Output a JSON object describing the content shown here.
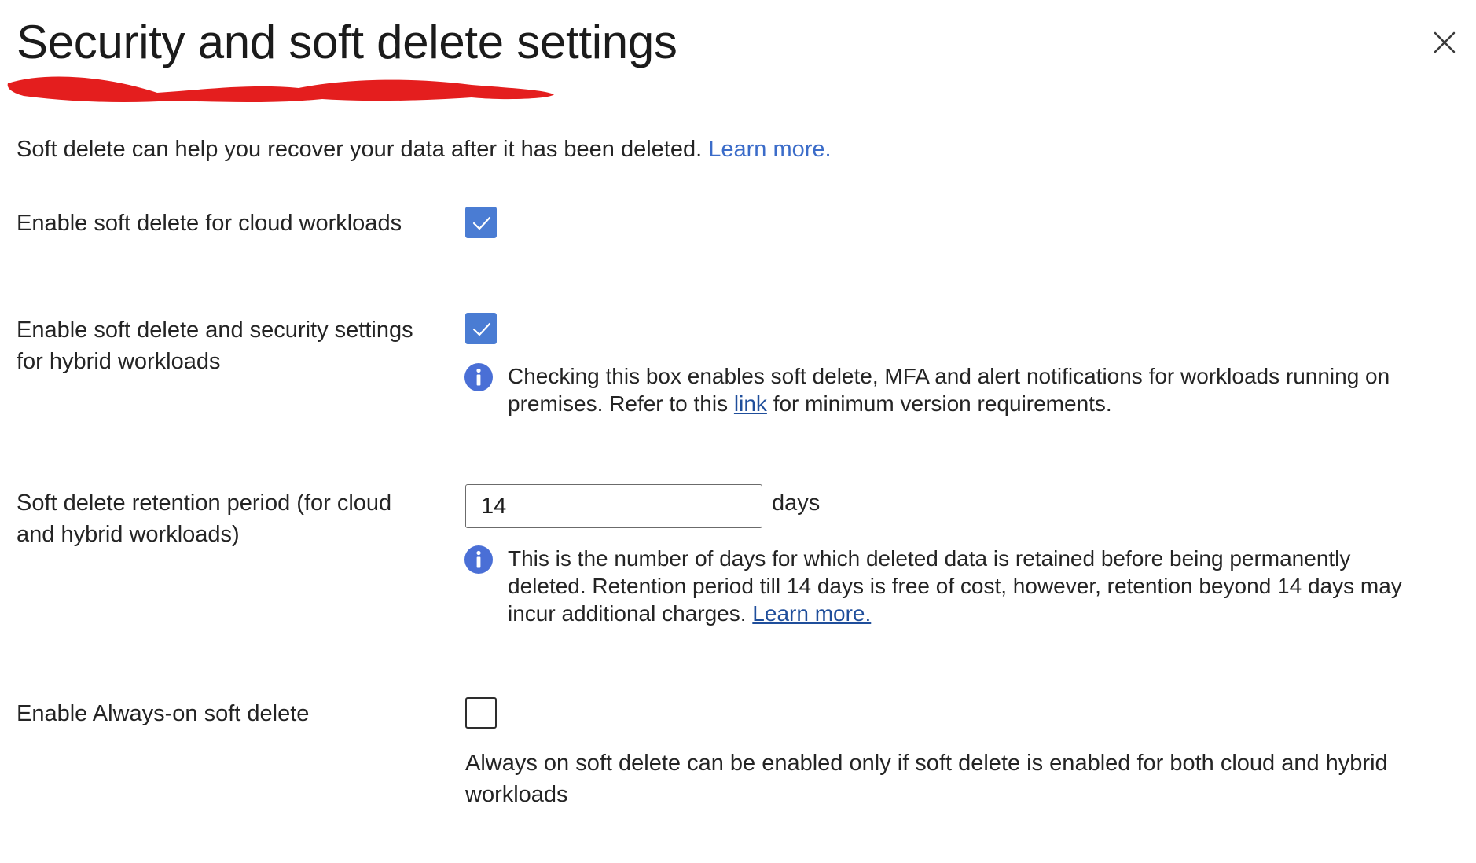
{
  "dialog": {
    "title": "Security and soft delete settings",
    "close_label": "Close"
  },
  "intro": {
    "text": "Soft delete can help you recover your data after it has been deleted.",
    "link": "Learn more."
  },
  "cloud_soft_delete": {
    "label": "Enable soft delete for cloud workloads",
    "checked": true
  },
  "hybrid_soft_delete": {
    "label": "Enable soft delete and security settings for hybrid workloads",
    "checked": true,
    "info_before_link": "Checking this box enables soft delete, MFA and alert notifications for workloads running on premises. Refer to this",
    "info_link": "link",
    "info_after_link": "for minimum version requirements."
  },
  "retention": {
    "label": "Soft delete retention period (for cloud and hybrid workloads)",
    "value": "14",
    "unit": "days",
    "info_text": "This is the number of days for which deleted data is retained before being permanently deleted. Retention period till 14 days is free of cost, however, retention beyond 14 days may incur additional charges.",
    "info_link": "Learn more."
  },
  "always_on": {
    "label": "Enable Always-on soft delete",
    "checked": false,
    "helper": "Always on soft delete can be enabled only if soft delete is enabled for both cloud and hybrid workloads"
  },
  "icons": {
    "close": "close-icon",
    "info": "info-icon",
    "check": "checkmark-icon"
  },
  "colors": {
    "accent": "#4a7cd3",
    "link": "#3b6cc9",
    "info_icon": "#4a6fd6",
    "redaction": "#e41e1e"
  }
}
